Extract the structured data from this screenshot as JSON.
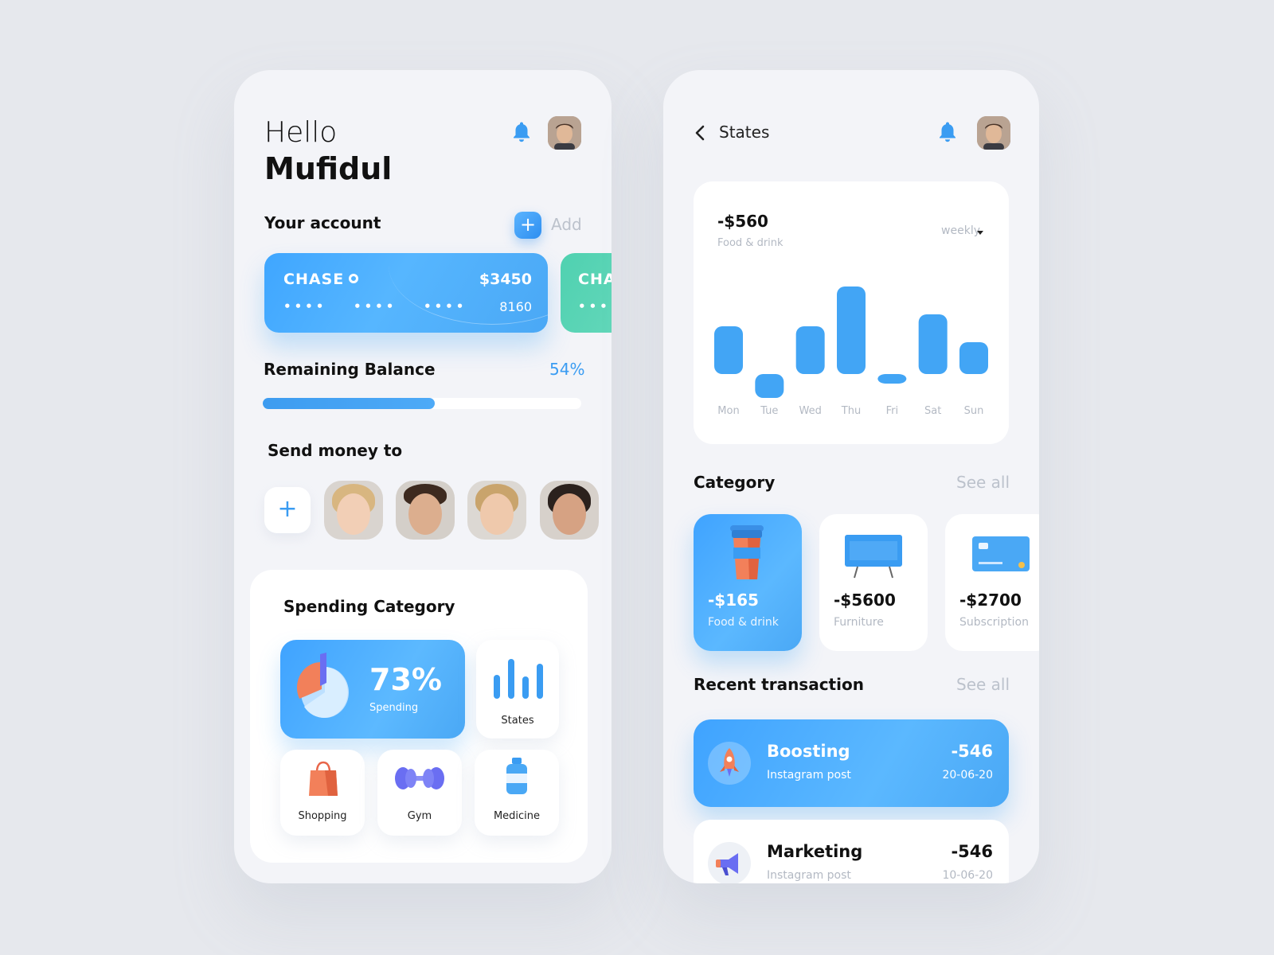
{
  "home": {
    "greeting": "Hello",
    "user_name": "Mufidul",
    "account_section": "Your account",
    "add_label": "Add",
    "add_symbol": "+",
    "cards": [
      {
        "bank": "CHASE",
        "amount": "$3450",
        "dots": [
          "••••",
          "••••",
          "••••"
        ],
        "last4": "8160",
        "color": "#4aa8f5"
      },
      {
        "bank": "CHA",
        "dots": [
          "•••"
        ],
        "color": "#5cd6b6"
      }
    ],
    "balance_label": "Remaining Balance",
    "balance_percent_label": "54%",
    "balance_fraction": 0.54,
    "send_money_label": "Send money to",
    "add_contact_symbol": "+",
    "spending_title": "Spending Category",
    "spending_percent": "73%",
    "spending_label": "Spending",
    "tiles": {
      "states": "States",
      "shopping": "Shopping",
      "gym": "Gym",
      "medicine": "Medicine"
    }
  },
  "states": {
    "title": "States",
    "total": "-$560",
    "total_category": "Food & drink",
    "period": "weekly",
    "category_section": "Category",
    "category_see_all": "See all",
    "categories": [
      {
        "amount": "-$165",
        "label": "Food & drink",
        "active": true
      },
      {
        "amount": "-$5600",
        "label": "Furniture",
        "active": false
      },
      {
        "amount": "-$2700",
        "label": "Subscription",
        "active": false
      }
    ],
    "recent_section": "Recent transaction",
    "recent_see_all": "See all",
    "transactions": [
      {
        "title": "Boosting",
        "subtitle": "Instagram post",
        "amount": "-546",
        "date": "20-06-20",
        "icon": "rocket-icon"
      },
      {
        "title": "Marketing",
        "subtitle": "Instagram post",
        "amount": "-546",
        "date": "10-06-20",
        "icon": "megaphone-icon"
      }
    ]
  },
  "chart_data": {
    "type": "bar",
    "categories": [
      "Mon",
      "Tue",
      "Wed",
      "Thu",
      "Fri",
      "Sat",
      "Sun"
    ],
    "values": [
      60,
      -30,
      60,
      110,
      -12,
      75,
      40
    ],
    "title": "",
    "xlabel": "",
    "ylabel": "",
    "color": "#42a5f5",
    "grid": false
  },
  "colors": {
    "accent": "#3a9cf2",
    "card_green": "#5cd6b6",
    "background": "#e6e8ed",
    "panel": "#f3f4f8"
  }
}
